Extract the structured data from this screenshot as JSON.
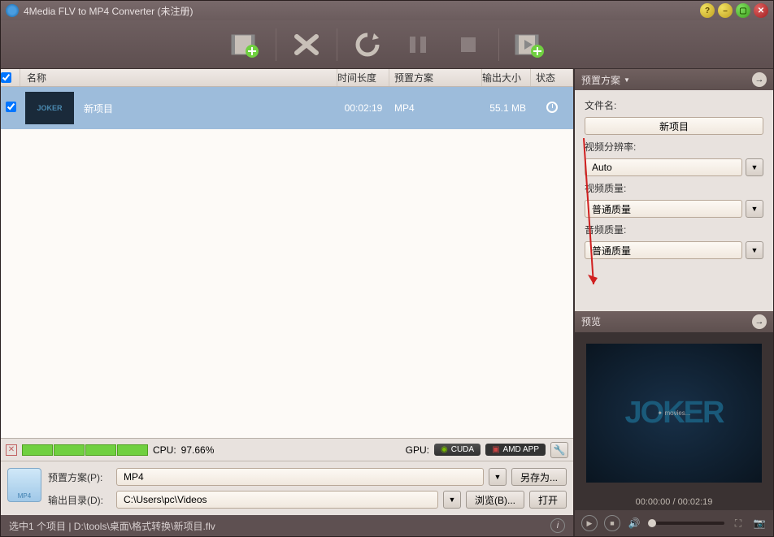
{
  "title": "4Media FLV to MP4 Converter (未注册)",
  "toolbar": {},
  "list": {
    "headers": {
      "name": "名称",
      "duration": "时间长度",
      "preset": "预置方案",
      "size": "输出大小",
      "status": "状态"
    },
    "rows": [
      {
        "checked": true,
        "thumb_text": "JOKER",
        "name": "新项目",
        "duration": "00:02:19",
        "preset": "MP4",
        "size": "55.1 MB",
        "status": "pending"
      }
    ]
  },
  "cpu": {
    "label": "CPU:",
    "value": "97.66%",
    "gpu_label": "GPU:",
    "cuda": "CUDA",
    "amd": "AMD APP"
  },
  "bottom": {
    "preset_label": "预置方案(P):",
    "preset_value": "MP4",
    "saveas": "另存为...",
    "output_label": "输出目录(D):",
    "output_value": "C:\\Users\\pc\\Videos",
    "browse": "浏览(B)...",
    "open": "打开",
    "icon_text": "MP4"
  },
  "status": "选中1 个项目 | D:\\tools\\桌面\\格式转换\\新项目.flv",
  "right": {
    "preset_header": "预置方案",
    "filename_label": "文件名:",
    "filename_value": "新项目",
    "resolution_label": "视频分辨率:",
    "resolution_value": "Auto",
    "vquality_label": "视频质量:",
    "vquality_value": "普通质量",
    "aquality_label": "音频质量:",
    "aquality_value": "普通质量",
    "preview_header": "预览",
    "preview_text": "JOKER",
    "preview_sub": "✦ movies... ",
    "time": "00:00:00 / 00:02:19"
  }
}
